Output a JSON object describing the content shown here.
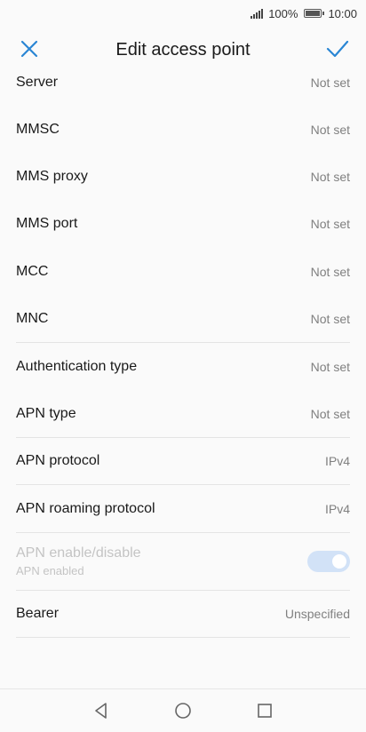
{
  "status_bar": {
    "battery_percent": "100%",
    "time": "10:00"
  },
  "app_bar": {
    "title": "Edit access point",
    "close_icon": "close-icon",
    "confirm_icon": "check-icon"
  },
  "settings": [
    {
      "label": "Server",
      "value": "Not set"
    },
    {
      "label": "MMSC",
      "value": "Not set"
    },
    {
      "label": "MMS proxy",
      "value": "Not set"
    },
    {
      "label": "MMS port",
      "value": "Not set"
    },
    {
      "label": "MCC",
      "value": "Not set"
    },
    {
      "label": "MNC",
      "value": "Not set"
    },
    {
      "label": "Authentication type",
      "value": "Not set"
    },
    {
      "label": "APN type",
      "value": "Not set"
    },
    {
      "label": "APN protocol",
      "value": "IPv4"
    },
    {
      "label": "APN roaming protocol",
      "value": "IPv4"
    }
  ],
  "apn_toggle": {
    "label": "APN enable/disable",
    "sublabel": "APN enabled",
    "enabled": true,
    "disabled": true
  },
  "bearer": {
    "label": "Bearer",
    "value": "Unspecified"
  },
  "nav_bar": {
    "back_icon": "back-icon",
    "home_icon": "home-icon",
    "recents_icon": "recents-icon"
  },
  "colors": {
    "accent": "#2a86d4",
    "toggle_track": "#d2e2f7"
  }
}
